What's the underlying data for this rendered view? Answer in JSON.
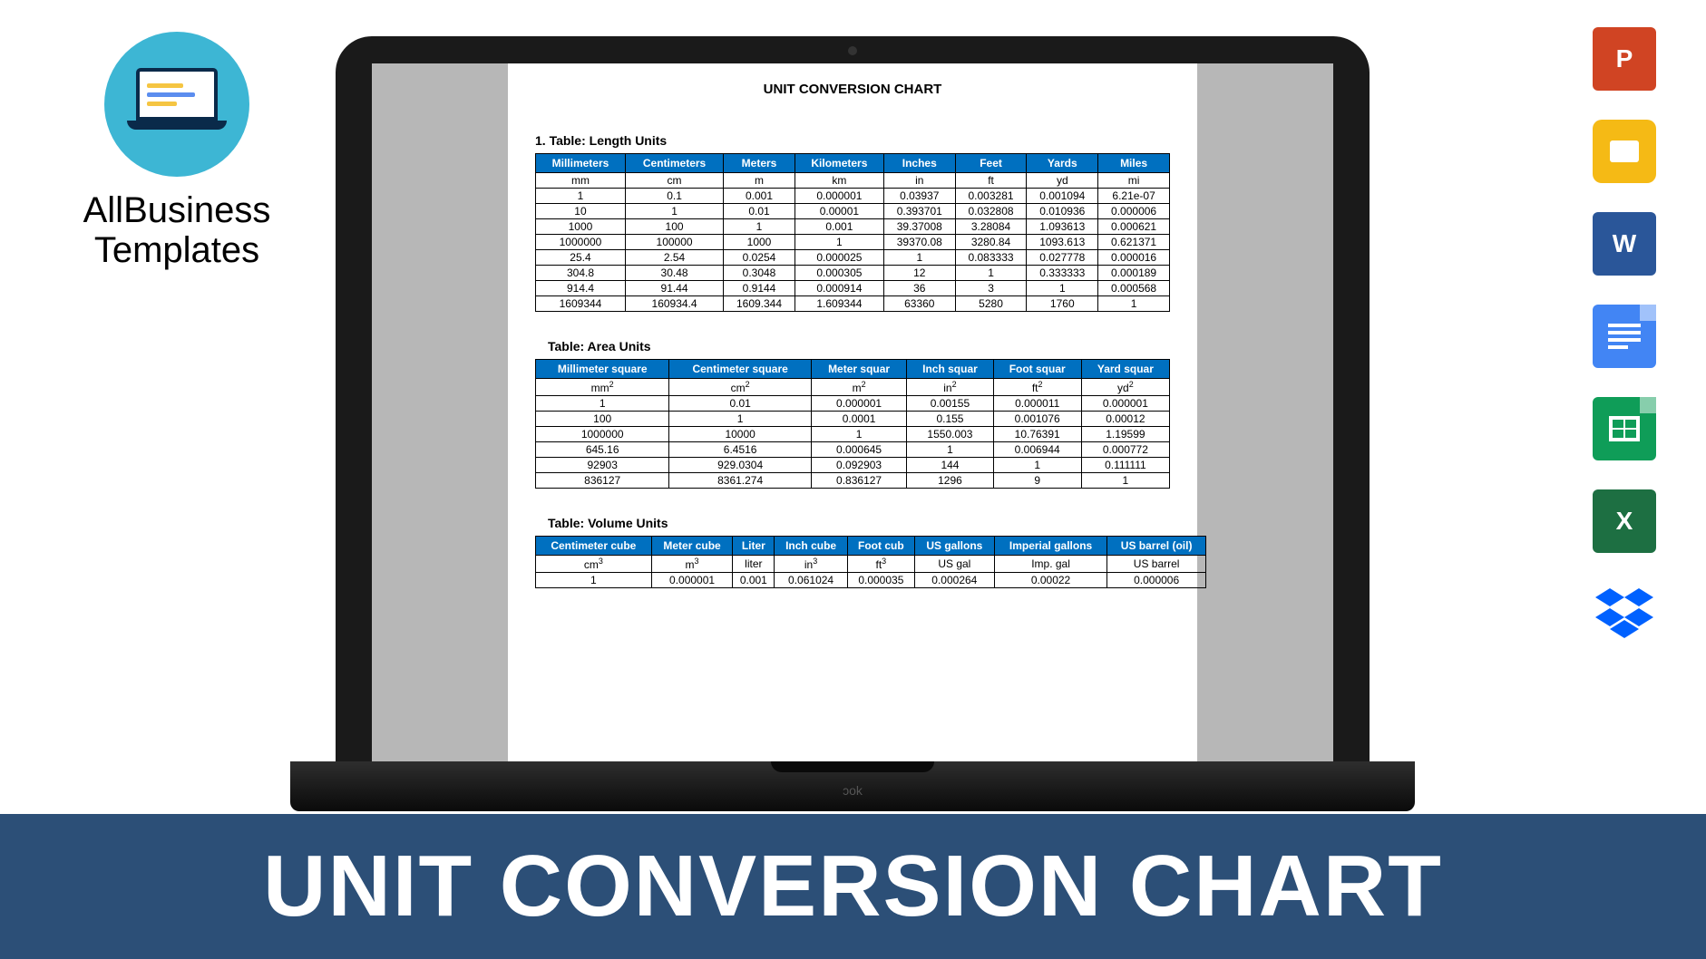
{
  "brand": {
    "line1": "AllBusiness",
    "line2": "Templates"
  },
  "banner_title": "UNIT CONVERSION CHART",
  "icons": {
    "powerpoint": "P",
    "slides": "",
    "word": "W",
    "docs": "",
    "sheets": "",
    "excel": "X",
    "dropbox": "⬢"
  },
  "doc": {
    "title": "UNIT CONVERSION CHART",
    "section1_label": "1.   Table:  Length Units",
    "section2_label": "Table:  Area Units",
    "section3_label": "Table:  Volume Units",
    "length": {
      "headers": [
        "Millimeters",
        "Centimeters",
        "Meters",
        "Kilometers",
        "Inches",
        "Feet",
        "Yards",
        "Miles"
      ],
      "units": [
        "mm",
        "cm",
        "m",
        "km",
        "in",
        "ft",
        "yd",
        "mi"
      ],
      "rows": [
        [
          "1",
          "0.1",
          "0.001",
          "0.000001",
          "0.03937",
          "0.003281",
          "0.001094",
          "6.21e-07"
        ],
        [
          "10",
          "1",
          "0.01",
          "0.00001",
          "0.393701",
          "0.032808",
          "0.010936",
          "0.000006"
        ],
        [
          "1000",
          "100",
          "1",
          "0.001",
          "39.37008",
          "3.28084",
          "1.093613",
          "0.000621"
        ],
        [
          "1000000",
          "100000",
          "1000",
          "1",
          "39370.08",
          "3280.84",
          "1093.613",
          "0.621371"
        ],
        [
          "25.4",
          "2.54",
          "0.0254",
          "0.000025",
          "1",
          "0.083333",
          "0.027778",
          "0.000016"
        ],
        [
          "304.8",
          "30.48",
          "0.3048",
          "0.000305",
          "12",
          "1",
          "0.333333",
          "0.000189"
        ],
        [
          "914.4",
          "91.44",
          "0.9144",
          "0.000914",
          "36",
          "3",
          "1",
          "0.000568"
        ],
        [
          "1609344",
          "160934.4",
          "1609.344",
          "1.609344",
          "63360",
          "5280",
          "1760",
          "1"
        ]
      ]
    },
    "area": {
      "headers": [
        "Millimeter square",
        "Centimeter square",
        "Meter squar",
        "Inch squar",
        "Foot squar",
        "Yard squar"
      ],
      "units": [
        "mm²",
        "cm²",
        "m²",
        "in²",
        "ft²",
        "yd²"
      ],
      "rows": [
        [
          "1",
          "0.01",
          "0.000001",
          "0.00155",
          "0.000011",
          "0.000001"
        ],
        [
          "100",
          "1",
          "0.0001",
          "0.155",
          "0.001076",
          "0.00012"
        ],
        [
          "1000000",
          "10000",
          "1",
          "1550.003",
          "10.76391",
          "1.19599"
        ],
        [
          "645.16",
          "6.4516",
          "0.000645",
          "1",
          "0.006944",
          "0.000772"
        ],
        [
          "92903",
          "929.0304",
          "0.092903",
          "144",
          "1",
          "0.111111"
        ],
        [
          "836127",
          "8361.274",
          "0.836127",
          "1296",
          "9",
          "1"
        ]
      ]
    },
    "volume": {
      "headers": [
        "Centimeter cube",
        "Meter cube",
        "Liter",
        "Inch cube",
        "Foot cub",
        "US gallons",
        "Imperial gallons",
        "US barrel (oil)"
      ],
      "units": [
        "cm³",
        "m³",
        "liter",
        "in³",
        "ft³",
        "US gal",
        "Imp. gal",
        "US barrel"
      ],
      "rows": [
        [
          "1",
          "0.000001",
          "0.001",
          "0.061024",
          "0.000035",
          "0.000264",
          "0.00022",
          "0.000006"
        ]
      ]
    }
  },
  "chart_data": [
    {
      "type": "table",
      "title": "Length Units",
      "columns": [
        "Millimeters",
        "Centimeters",
        "Meters",
        "Kilometers",
        "Inches",
        "Feet",
        "Yards",
        "Miles"
      ],
      "unit_row": [
        "mm",
        "cm",
        "m",
        "km",
        "in",
        "ft",
        "yd",
        "mi"
      ],
      "data": [
        [
          1,
          0.1,
          0.001,
          1e-06,
          0.03937,
          0.003281,
          0.001094,
          6.21e-07
        ],
        [
          10,
          1,
          0.01,
          1e-05,
          0.393701,
          0.032808,
          0.010936,
          6e-06
        ],
        [
          1000,
          100,
          1,
          0.001,
          39.37008,
          3.28084,
          1.093613,
          0.000621
        ],
        [
          1000000,
          100000,
          1000,
          1,
          39370.08,
          3280.84,
          1093.613,
          0.621371
        ],
        [
          25.4,
          2.54,
          0.0254,
          2.5e-05,
          1,
          0.083333,
          0.027778,
          1.6e-05
        ],
        [
          304.8,
          30.48,
          0.3048,
          0.000305,
          12,
          1,
          0.333333,
          0.000189
        ],
        [
          914.4,
          91.44,
          0.9144,
          0.000914,
          36,
          3,
          1,
          0.000568
        ],
        [
          1609344,
          160934.4,
          1609.344,
          1.609344,
          63360,
          5280,
          1760,
          1
        ]
      ]
    },
    {
      "type": "table",
      "title": "Area Units",
      "columns": [
        "Millimeter square",
        "Centimeter square",
        "Meter square",
        "Inch square",
        "Foot square",
        "Yard square"
      ],
      "unit_row": [
        "mm²",
        "cm²",
        "m²",
        "in²",
        "ft²",
        "yd²"
      ],
      "data": [
        [
          1,
          0.01,
          1e-06,
          0.00155,
          1.1e-05,
          1e-06
        ],
        [
          100,
          1,
          0.0001,
          0.155,
          0.001076,
          0.00012
        ],
        [
          1000000,
          10000,
          1,
          1550.003,
          10.76391,
          1.19599
        ],
        [
          645.16,
          6.4516,
          0.000645,
          1,
          0.006944,
          0.000772
        ],
        [
          92903,
          929.0304,
          0.092903,
          144,
          1,
          0.111111
        ],
        [
          836127,
          8361.274,
          0.836127,
          1296,
          9,
          1
        ]
      ]
    },
    {
      "type": "table",
      "title": "Volume Units",
      "columns": [
        "Centimeter cube",
        "Meter cube",
        "Liter",
        "Inch cube",
        "Foot cube",
        "US gallons",
        "Imperial gallons",
        "US barrel (oil)"
      ],
      "unit_row": [
        "cm³",
        "m³",
        "liter",
        "in³",
        "ft³",
        "US gal",
        "Imp. gal",
        "US barrel"
      ],
      "data": [
        [
          1,
          1e-06,
          0.001,
          0.061024,
          3.5e-05,
          0.000264,
          0.00022,
          6e-06
        ]
      ]
    }
  ]
}
